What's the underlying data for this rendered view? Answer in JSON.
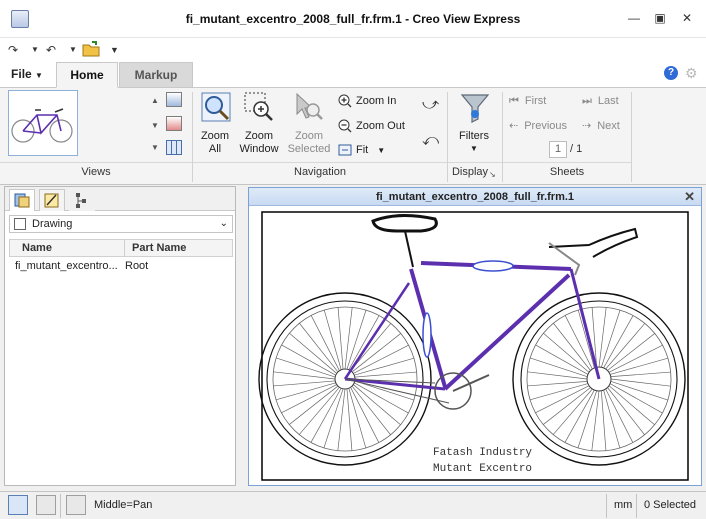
{
  "window": {
    "title": "fi_mutant_excentro_2008_full_fr.frm.1 - Creo View Express",
    "minimize_icon": "minimize-icon",
    "maximize_icon": "maximize-icon",
    "close_icon": "close-icon"
  },
  "quick_access": {
    "items": [
      "redo-icon",
      "undo-icon",
      "open-folder-icon",
      "customize-dropdown-icon"
    ]
  },
  "tabs": {
    "file": "File",
    "home": "Home",
    "markup": "Markup"
  },
  "ribbon": {
    "views": {
      "label": "Views"
    },
    "navigation": {
      "label": "Navigation",
      "zoom_all": [
        "Zoom",
        "All"
      ],
      "zoom_window": [
        "Zoom",
        "Window"
      ],
      "zoom_selected": [
        "Zoom",
        "Selected"
      ],
      "zoom_in": "Zoom In",
      "zoom_out": "Zoom Out",
      "fit": "Fit"
    },
    "display": {
      "label": "Display",
      "filters": "Filters"
    },
    "sheets": {
      "label": "Sheets",
      "first": "First",
      "last": "Last",
      "previous": "Previous",
      "next": "Next",
      "current_page": "1",
      "total_pages": "/ 1"
    }
  },
  "structure_panel": {
    "select_value": "Drawing",
    "columns": {
      "name": "Name",
      "part_name": "Part Name"
    },
    "rows": [
      {
        "name": "fi_mutant_excentro...",
        "part_name": "Root"
      }
    ]
  },
  "drawing_window": {
    "title": "fi_mutant_excentro_2008_full_fr.frm.1",
    "close": "✕",
    "caption_line1": "Fatash Industry",
    "caption_line2": "Mutant Excentro"
  },
  "status": {
    "mode": "Middle=Pan",
    "units": "mm",
    "selected": "0 Selected"
  },
  "colors": {
    "accent": "#7aa2d6",
    "frame": "#5b2fae",
    "frame_fill": "#3a4fd0"
  }
}
